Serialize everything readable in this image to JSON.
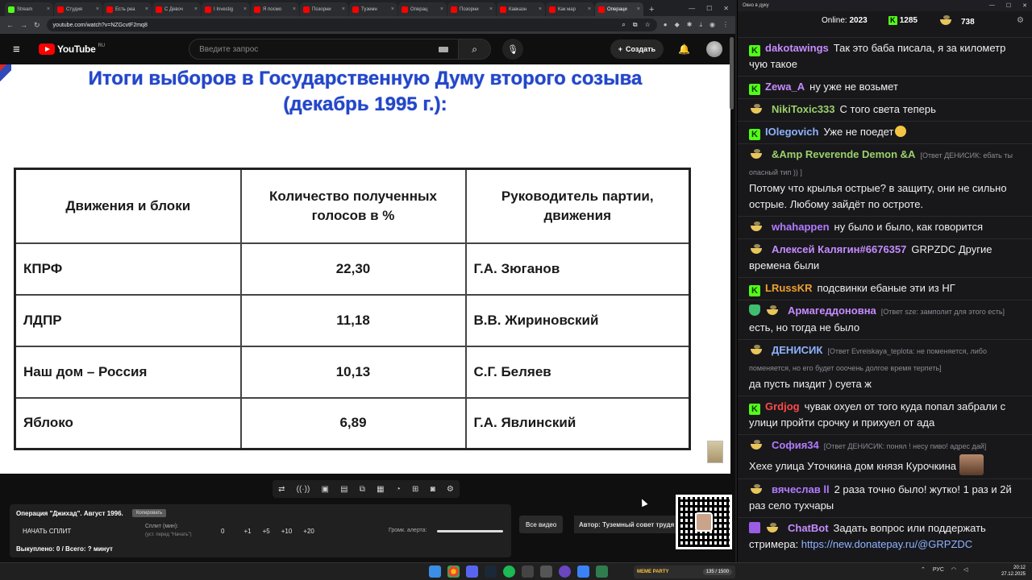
{
  "browser": {
    "tabs": [
      {
        "label": "Stream",
        "color": "#53fc18"
      },
      {
        "label": "Студия",
        "color": "#ff0000"
      },
      {
        "label": "Есть реа",
        "color": "#ff0000"
      },
      {
        "label": "С Девоч",
        "color": "#ff0000"
      },
      {
        "label": "I Investig",
        "color": "#ff0000"
      },
      {
        "label": "Я посмо",
        "color": "#ff0000"
      },
      {
        "label": "Позорни",
        "color": "#ff0000"
      },
      {
        "label": "Туземн",
        "color": "#ff0000"
      },
      {
        "label": "Операц",
        "color": "#ff0000"
      },
      {
        "label": "Позорни",
        "color": "#ff0000"
      },
      {
        "label": "Кавказн",
        "color": "#ff0000"
      },
      {
        "label": "Как мар",
        "color": "#ff0000"
      },
      {
        "label": "Операци",
        "color": "#ff0000"
      }
    ],
    "url": "youtube.com/watch?v=NZGcvtF2mq8"
  },
  "youtube": {
    "logo": "YouTube",
    "region": "RU",
    "search_placeholder": "Введите запрос",
    "create_label": "Создать"
  },
  "slide": {
    "title_line1": "Итоги выборов в Государственную Думу второго созыва",
    "title_line2": "(декабрь 1995 г.):",
    "headers": [
      "Движения и блоки",
      "Количество полученных голосов в %",
      "Руководитель партии, движения"
    ],
    "rows": [
      {
        "party": "КПРФ",
        "votes": "22,30",
        "leader": "Г.А. Зюганов"
      },
      {
        "party": "ЛДПР",
        "votes": "11,18",
        "leader": "В.В. Жириновский"
      },
      {
        "party": "Наш дом – Россия",
        "votes": "10,13",
        "leader": "С.Г. Беляев"
      },
      {
        "party": "Яблоко",
        "votes": "6,89",
        "leader": "Г.А. Явлинский"
      }
    ]
  },
  "split_panel": {
    "title": "Операция \"Джихад\". Август 1996.",
    "copy_label": "Копировать",
    "start_label": "НАЧАТЬ СПЛИТ",
    "split_label": "Сплит (мин):",
    "split_hint": "(уст. перед \"Начать\")",
    "buttons": [
      "0",
      "+1",
      "+5",
      "+10",
      "+20"
    ],
    "alert_label": "Громк. алерта:",
    "footer": "Выкуплено: 0 / Всего: ? минут"
  },
  "all_video_label": "Все видео",
  "author_label": "Автор: Туземный совет трудя",
  "chat": {
    "window_title": "Окно в дуку",
    "online_label": "Online:",
    "online_count": "2023",
    "stat_k": "1285",
    "stat_bowl": "738",
    "messages": [
      {
        "badge": "k",
        "user": "dakotawings",
        "color": "#c68cff",
        "text": "Так это баба писала, я за километр чую такое"
      },
      {
        "badge": "k",
        "user": "Zewa_A",
        "color": "#c68cff",
        "text": "ну уже не возьмет"
      },
      {
        "badge": "bowl",
        "user": "NikiToxic333",
        "color": "#9ad16b",
        "text": "С того света теперь"
      },
      {
        "badge": "k",
        "user": "IOlegovich",
        "color": "#8fb3ff",
        "text": "Уже не поедет"
      },
      {
        "badge": "bowl",
        "user": "&Amp Reverende Demon &A",
        "color": "#9ad16b",
        "reply": "[Ответ ДЕНИСИК: ебать ты опасный тип )) ]",
        "text": "Потому что крылья острые? в защиту, они не сильно острые. Любому зайдёт по остроте."
      },
      {
        "badge": "bowl",
        "user": "whahappen",
        "color": "#b37bff",
        "text": "ну было и было, как говорится"
      },
      {
        "badge": "bowl",
        "user": "Алексей Калягин#6676357",
        "color": "#c68cff",
        "text": "GRPZDC Другие времена были"
      },
      {
        "badge": "k",
        "user": "LRussKR",
        "color": "#f0a030",
        "text": "подсвинки ебаные эти из НГ"
      },
      {
        "badge": "shield",
        "user": "Армагеддоновна",
        "color": "#c68cff",
        "reply": "[Ответ sze: замполит для этого есть]",
        "text": "есть, но тогда не было"
      },
      {
        "badge": "bowl",
        "user": "ДЕНИСИК",
        "color": "#8fb3ff",
        "reply": "[Ответ Evreiskaya_teplota: не поменяется, либо поменяется, но его будет ооочень долгое время терпеть]",
        "text": "да пусть пиздит ) суета  ж"
      },
      {
        "badge": "k",
        "user": "Grdjog",
        "color": "#ff4a4a",
        "text": "чувак охуел от того куда попал забрали с улици пройти срочку и прихуел от ада"
      },
      {
        "badge": "bowl",
        "user": "София34",
        "color": "#b37bff",
        "reply": "[Ответ ДЕНИСИК: понял ! несу пиво! адрес дай]",
        "text": "Хехе улица Уточкина дом князя Курочкина"
      },
      {
        "badge": "bowl",
        "user": "вячеслав ll",
        "color": "#b37bff",
        "text": "2 раза точно было! жутко! 1 раз и 2й раз село тухчары"
      },
      {
        "badge": "robot",
        "user": "ChatBot",
        "color": "#c68cff",
        "text": "Задать вопрос или поддержать стримера: ",
        "link": "https://new.donatepay.ru/@GRPZDC"
      }
    ]
  },
  "taskbar": {
    "widget_label": "MEME PARTY",
    "widget_count": "135 / 1500",
    "lang": "РУС",
    "time": "20:12",
    "date": "27.12.2025"
  }
}
